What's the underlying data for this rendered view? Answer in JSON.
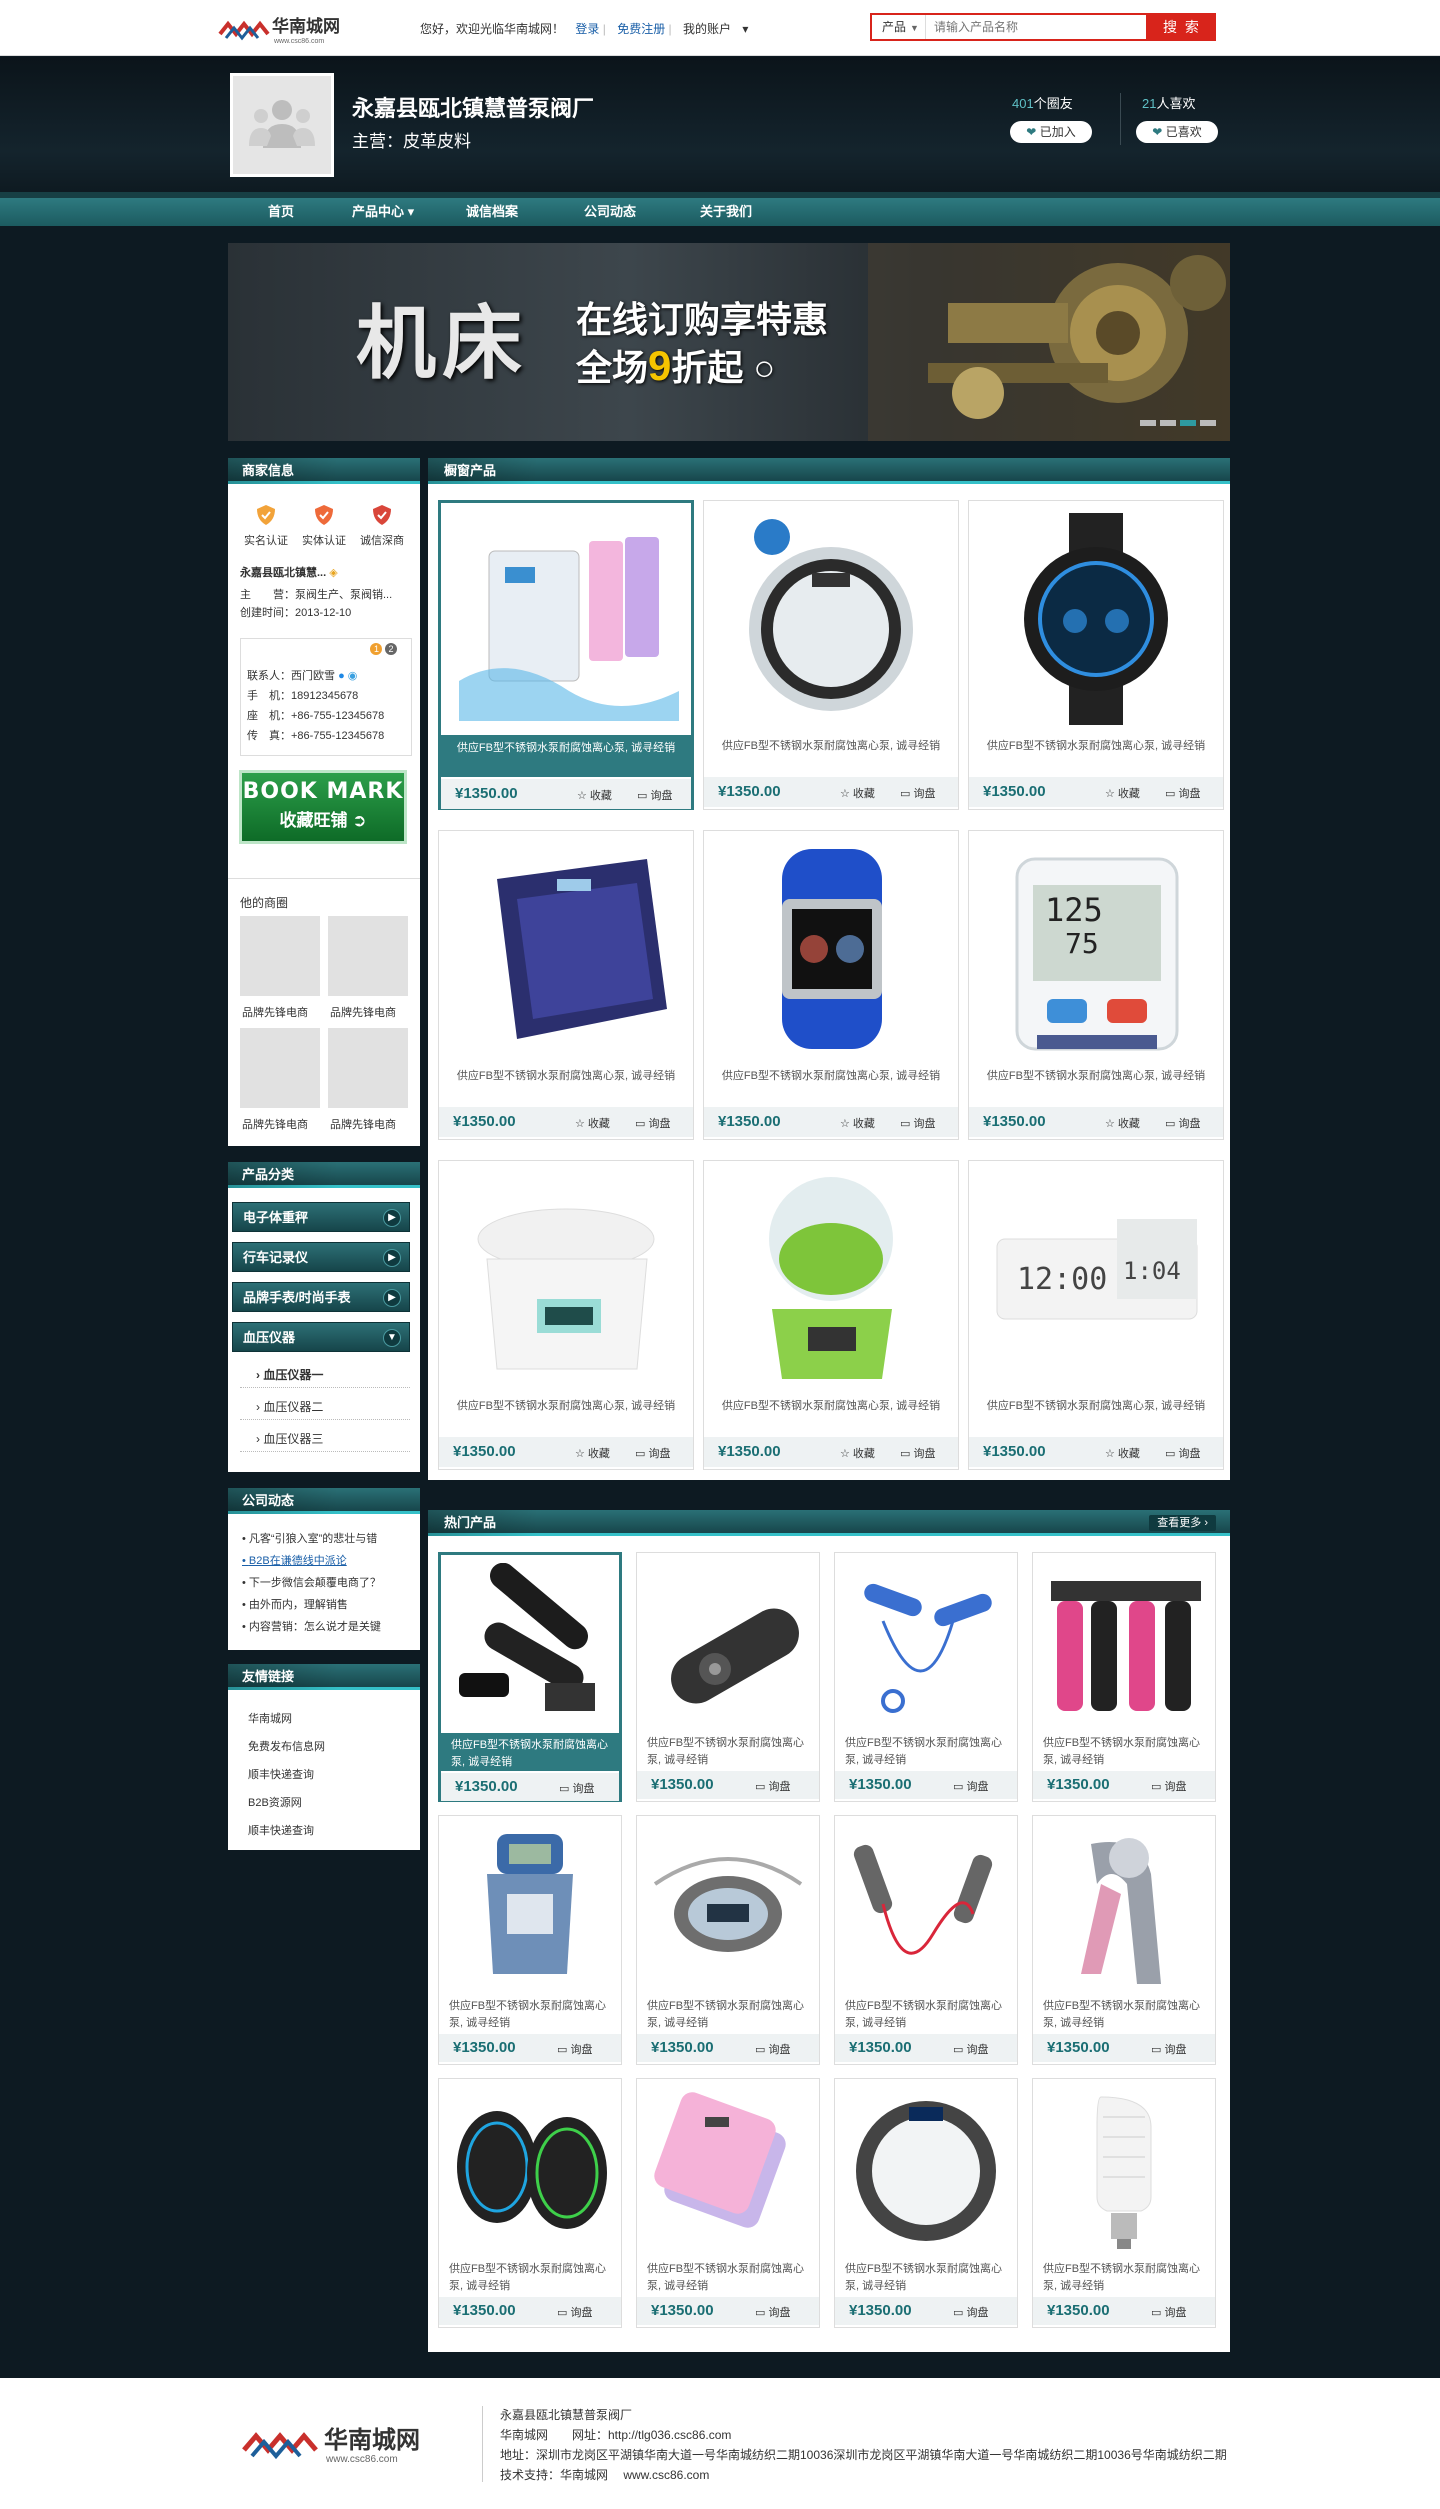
{
  "topbar": {
    "logo_text": "华南城网",
    "logo_sub": "www.csc86.com",
    "welcome": "您好，欢迎光临华南城网！",
    "login": "登录",
    "register": "免费注册",
    "account": "我的账户",
    "search_category": "产品",
    "search_placeholder": "请输入产品名称",
    "search_button": "搜 索"
  },
  "header": {
    "shop_name": "永嘉县瓯北镇慧普泵阀厂",
    "main_business": "主营：皮革皮料",
    "circle_count": "401",
    "circle_label": "个圈友",
    "joined_button": "已加入",
    "like_count": "21",
    "like_label": "人喜欢",
    "liked_button": "已喜欢"
  },
  "nav": {
    "items": [
      "首页",
      "产品中心 ▾",
      "诚信档案",
      "公司动态",
      "关于我们"
    ]
  },
  "banner": {
    "big_text": "机床",
    "line1": "在线订购享特惠",
    "line2_pre": "全场",
    "line2_num": "9",
    "line2_post": "折起"
  },
  "merchant": {
    "title": "商家信息",
    "badges": [
      "实名认证",
      "实体认证",
      "诚信深商"
    ],
    "company": "永嘉县瓯北镇慧...",
    "main_label": "主　　营：",
    "main_value": "泵阀生产、泵阀销...",
    "created_label": "创建时间：",
    "created_value": "2013-12-10",
    "contact_name": "联系人：西门欧雪",
    "mobile": "手　机：18912345678",
    "phone": "座　机：+86-755-12345678",
    "fax": "传　真：+86-755-12345678",
    "bookmark_en": "BOOK MARK",
    "bookmark_cn": "收藏旺铺",
    "other_shops": "他的商圈",
    "shop_labels": [
      "品牌先锋电商",
      "品牌先锋电商",
      "品牌先锋电商",
      "品牌先锋电商"
    ]
  },
  "categories": {
    "title": "产品分类",
    "items": [
      "电子体重秤",
      "行车记录仪",
      "品牌手表/时尚手表",
      "血压仪器"
    ],
    "sub_items": [
      "血压仪器一",
      "血压仪器二",
      "血压仪器三"
    ]
  },
  "news": {
    "title": "公司动态",
    "items": [
      "凡客“引狼入室”的悲壮与错",
      "B2B在谦德线中派论",
      "下一步微信会颠覆电商了？",
      "由外而内，理解销售",
      "内容营销：怎么说才是关键"
    ]
  },
  "links": {
    "title": "友情链接",
    "items": [
      "华南城网",
      "免费发布信息网",
      "顺丰快递查询",
      "B2B资源网",
      "顺丰快递查询"
    ]
  },
  "showcase": {
    "title": "橱窗产品",
    "product_title": "供应FB型不锈钢水泵耐腐蚀离心泵, 诚寻经销",
    "price": "¥1350.00",
    "fav_label": "收藏",
    "ask_label": "询盘",
    "icons": [
      "scale-icon",
      "round-scale-icon",
      "watch-icon",
      "glass-scale-icon",
      "blue-watch-icon",
      "blood-pressure-icon",
      "kitchen-scale-icon",
      "green-scale-icon",
      "clock-icon"
    ]
  },
  "hot": {
    "title": "热门产品",
    "more": "查看更多",
    "product_title": "供应FB型不锈钢水泵耐腐蚀离心泵, 诚寻经销",
    "price": "¥1350.00",
    "ask_label": "询盘",
    "icons": [
      "pen-icon",
      "remote-icon",
      "jump-rope-icon",
      "grip-icon",
      "dynamometer-icon",
      "pedometer-icon",
      "red-rope-icon",
      "hand-grip-icon",
      "speaker-icon",
      "pink-scale-icon",
      "ring-scale-icon",
      "bulb-icon"
    ]
  },
  "footer": {
    "logo_text": "华南城网",
    "logo_sub": "www.csc86.com",
    "company": "永嘉县瓯北镇慧普泵阀厂",
    "site_line": "华南城网　　网址：http://tlg036.csc86.com",
    "address": "地址：深圳市龙岗区平湖镇华南大道一号华南城纺织二期10036深圳市龙岗区平湖镇华南大道一号华南城纺织二期10036号华南城纺织二期",
    "support": "技术支持：华南城网　 www.csc86.com"
  },
  "colors": {
    "accent": "#2e7a80",
    "brand_red": "#d8241b",
    "bg_dark": "#0d1a22"
  }
}
